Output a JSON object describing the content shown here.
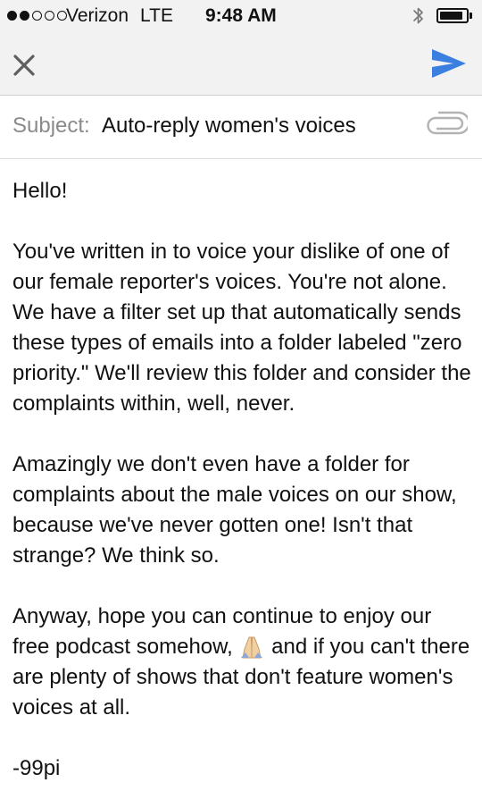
{
  "status_bar": {
    "carrier": "Verizon",
    "network": "LTE",
    "time": "9:48 AM",
    "signal_bars_filled": 2,
    "signal_bars_total": 5,
    "battery_level": 0.9
  },
  "toolbar": {
    "close_icon": "close-x-icon",
    "send_icon": "send-paper-plane-icon",
    "accent_color": "#3b7fe0"
  },
  "subject": {
    "label": "Subject:",
    "value": "Auto-reply women's voices",
    "attach_icon": "paperclip-icon"
  },
  "message": {
    "greeting": "Hello!",
    "paragraph1": "You've written in to voice your dislike of one of our female reporter's voices. You're not alone. We have a filter set up that automatically sends these types of emails into a folder labeled \"zero priority.\" We'll review this folder and consider the complaints within, well, never.",
    "paragraph2": "Amazingly we don't even have a folder for complaints about the male voices on our show, because we've never gotten one! Isn't that strange? We think so.",
    "paragraph3_before_emoji": "Anyway, hope you can continue to enjoy our free podcast somehow,",
    "paragraph3_emoji": "praying-hands-emoji",
    "paragraph3_after_emoji": "and if you can't there are plenty of shows that don't feature women's voices at all.",
    "signature": "-99pi"
  }
}
